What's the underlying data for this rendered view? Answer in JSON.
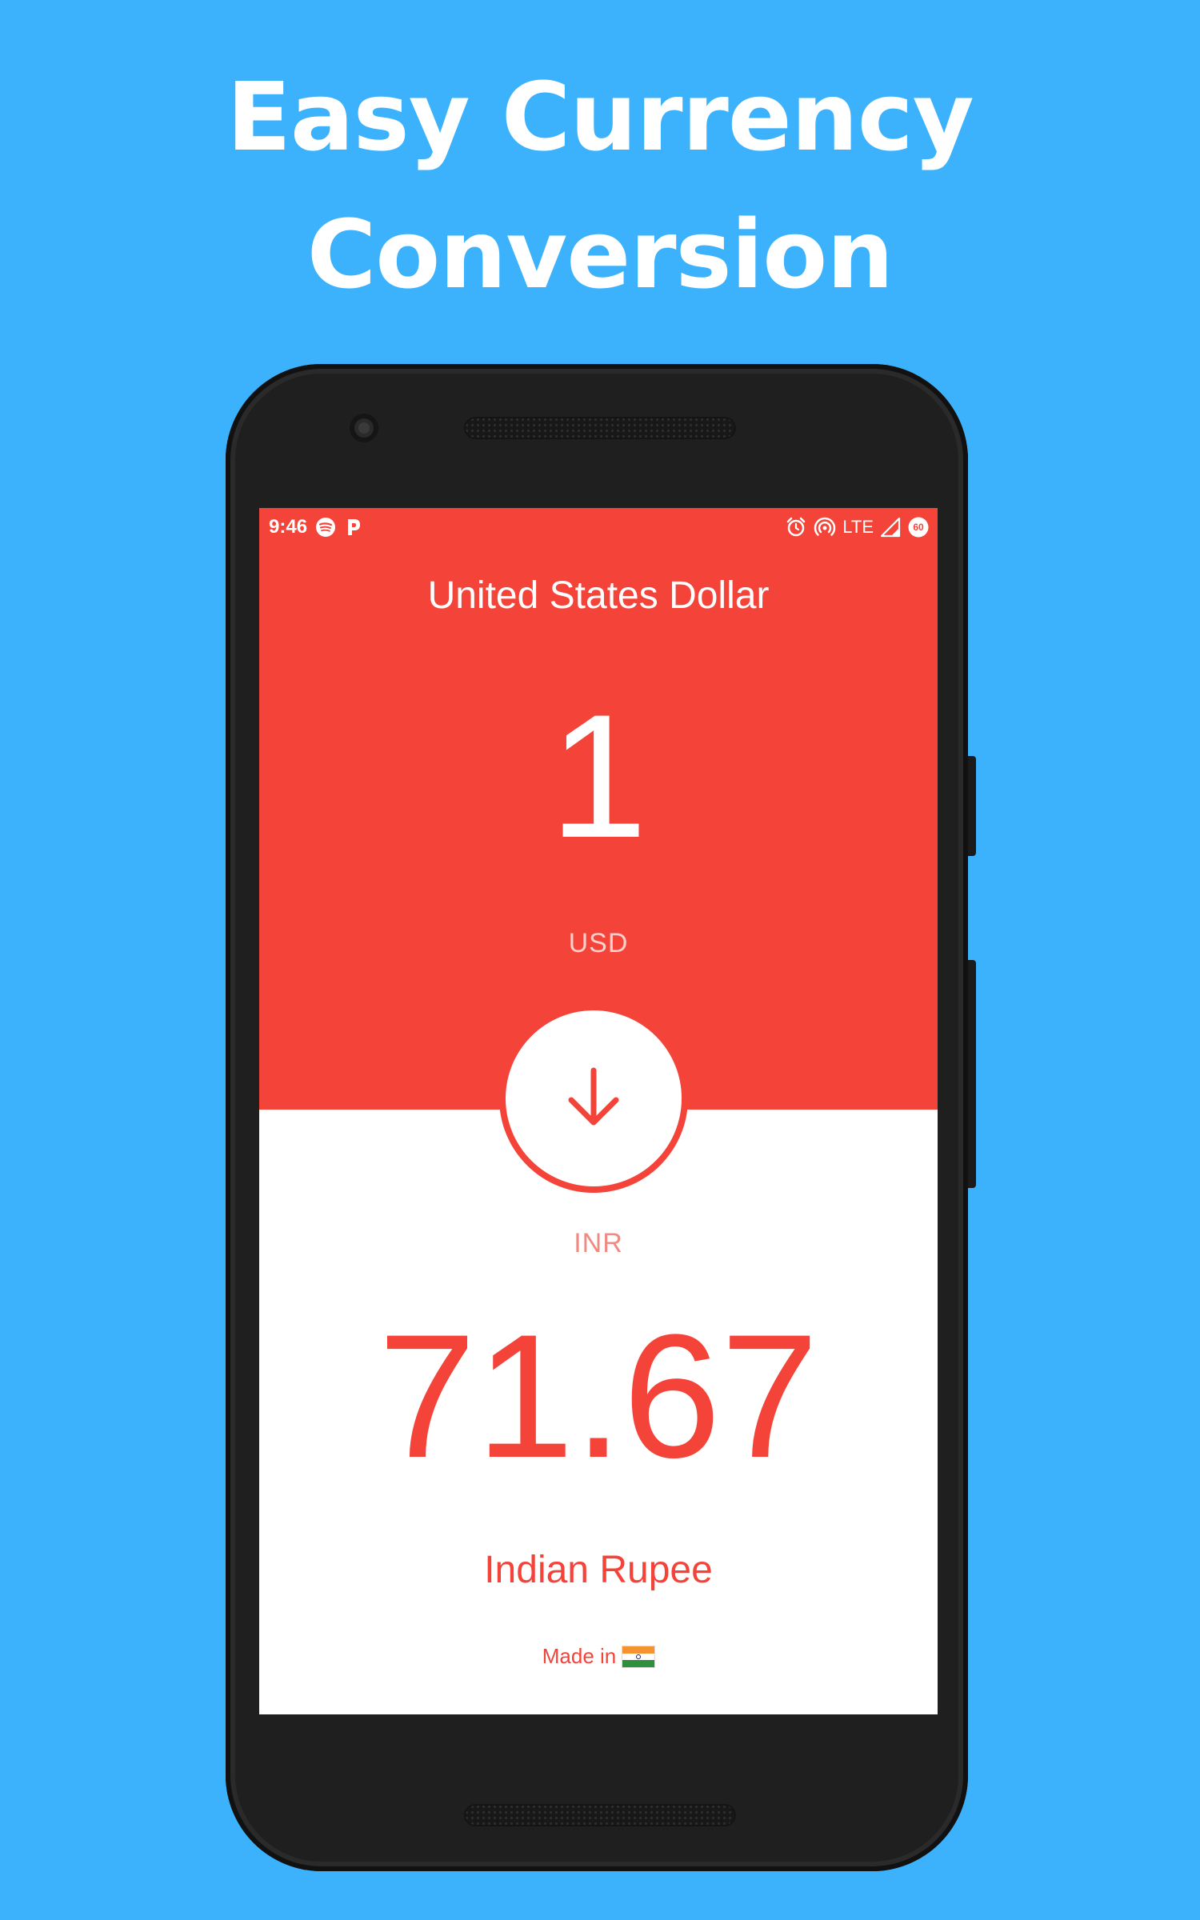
{
  "headline": {
    "line1": "Easy Currency",
    "line2": "Conversion"
  },
  "status_bar": {
    "time": "9:46",
    "network": "LTE",
    "battery": "60",
    "left_icons": [
      "spotify-icon",
      "pandora-icon"
    ],
    "right_icons": [
      "alarm-icon",
      "hotspot-icon",
      "signal-icon",
      "battery-icon"
    ]
  },
  "converter": {
    "from": {
      "name": "United States Dollar",
      "amount": "1",
      "code": "USD"
    },
    "swap_icon": "arrow-down-icon",
    "to": {
      "code": "INR",
      "amount": "71.67",
      "name": "Indian Rupee"
    },
    "footer_label": "Made in",
    "footer_flag": "india-flag-icon"
  },
  "colors": {
    "background": "#3bb2fb",
    "accent": "#f4443a",
    "screen_bottom": "#ffffff",
    "phone_body": "#1f1f1f"
  }
}
